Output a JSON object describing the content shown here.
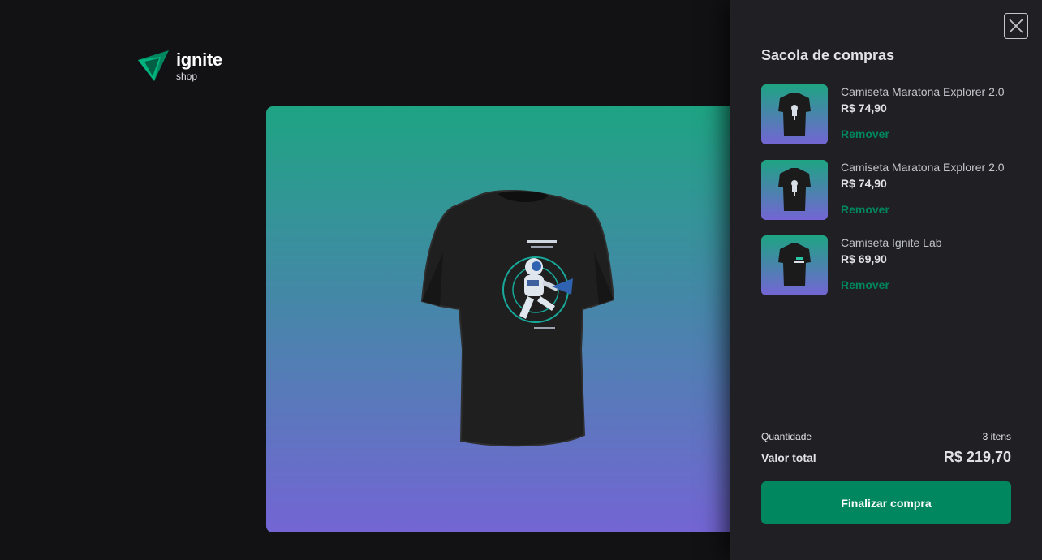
{
  "header": {
    "logo_name": "ignite",
    "logo_sub": "shop",
    "icon": "ignite-triangle-logo"
  },
  "hero": {
    "icon": "astronaut-tshirt-image"
  },
  "cart": {
    "title": "Sacola de compras",
    "close_icon": "close-icon",
    "items": [
      {
        "name": "Camiseta Maratona Explorer 2.0",
        "price": "R$ 74,90",
        "remove_label": "Remover",
        "icon": "tshirt-icon"
      },
      {
        "name": "Camiseta Maratona Explorer 2.0",
        "price": "R$ 74,90",
        "remove_label": "Remover",
        "icon": "tshirt-icon"
      },
      {
        "name": "Camiseta Ignite Lab",
        "price": "R$ 69,90",
        "remove_label": "Remover",
        "icon": "tshirt-icon"
      }
    ],
    "quantity_label": "Quantidade",
    "quantity_value": "3 itens",
    "total_label": "Valor total",
    "total_value": "R$ 219,70",
    "checkout_label": "Finalizar compra"
  },
  "colors": {
    "background": "#121214",
    "drawer": "#202024",
    "accent_green": "#00875f",
    "gradient_top": "#1ea483",
    "gradient_bottom": "#7465d4"
  }
}
